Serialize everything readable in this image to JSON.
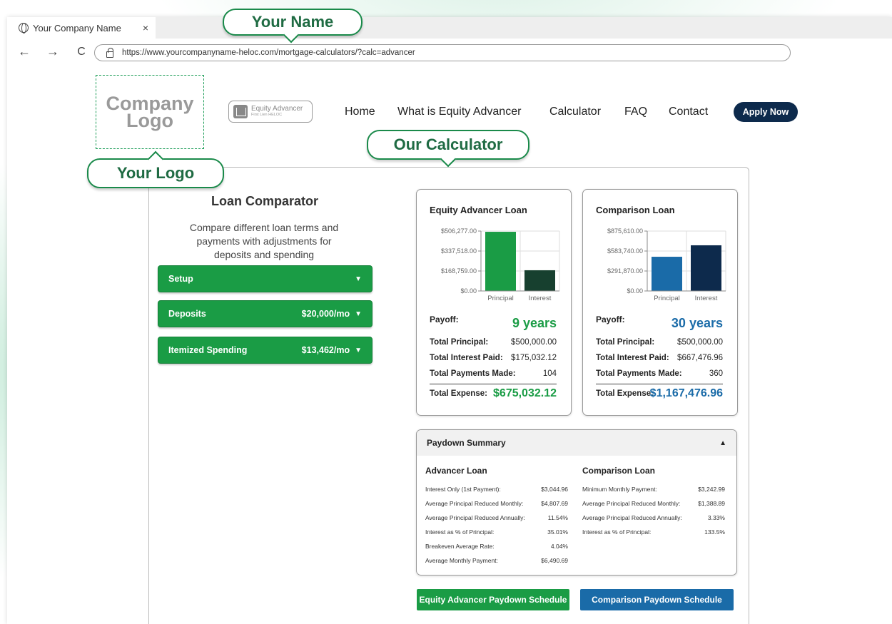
{
  "browser": {
    "tab_title": "Your Company Name",
    "tab_close": "×",
    "back": "←",
    "forward": "→",
    "reload": "C",
    "url": "https://www.yourcompanyname-heloc.com/mortgage-calculators/?calc=advancer"
  },
  "callouts": {
    "name": "Your Name",
    "logo": "Your Logo",
    "calculator": "Our Calculator"
  },
  "header": {
    "logo_line1": "Company",
    "logo_line2": "Logo",
    "badge_name": "Equity Advancer",
    "badge_sub": "First Lien HELOC",
    "nav": [
      "Home",
      "What is Equity Advancer",
      "Calculator",
      "FAQ",
      "Contact"
    ],
    "apply": "Apply Now"
  },
  "comparator": {
    "title": "Loan Comparator",
    "description": "Compare different loan terms and payments with adjustments for deposits and spending",
    "sections": [
      {
        "label": "Setup",
        "value": "",
        "arrow": "▼"
      },
      {
        "label": "Deposits",
        "value": "$20,000/mo",
        "arrow": "▼"
      },
      {
        "label": "Itemized Spending",
        "value": "$13,462/mo",
        "arrow": "▼"
      }
    ]
  },
  "colors": {
    "green": "#1a9c45",
    "dark_green": "#17402f",
    "blue": "#1a6ba8",
    "navy": "#0d2a4c"
  },
  "cards": [
    {
      "title": "Equity Advancer Loan",
      "payoff_label": "Payoff:",
      "payoff": "9 years",
      "rows": [
        {
          "label": "Total Principal:",
          "value": "$500,000.00"
        },
        {
          "label": "Total Interest Paid:",
          "value": "$175,032.12"
        },
        {
          "label": "Total Payments Made:",
          "value": "104"
        }
      ],
      "total_label": "Total Expense:",
      "total": "$675,032.12",
      "chart_data": {
        "type": "bar",
        "categories": [
          "Principal",
          "Interest"
        ],
        "values": [
          500000,
          175032.12
        ],
        "yticks": [
          0,
          168759,
          337518,
          506277
        ],
        "ytick_labels": [
          "$0.00",
          "$168,759.00",
          "$337,518.00",
          "$506,277.00"
        ],
        "ylim": [
          0,
          506277
        ],
        "colors": [
          "#1a9c45",
          "#17402f"
        ]
      }
    },
    {
      "title": "Comparison Loan",
      "payoff_label": "Payoff:",
      "payoff": "30 years",
      "rows": [
        {
          "label": "Total Principal:",
          "value": "$500,000.00"
        },
        {
          "label": "Total Interest Paid:",
          "value": "$667,476.96"
        },
        {
          "label": "Total Payments Made:",
          "value": "360"
        }
      ],
      "total_label": "Total Expense:",
      "total": "$1,167,476.96",
      "chart_data": {
        "type": "bar",
        "categories": [
          "Principal",
          "Interest"
        ],
        "values": [
          500000,
          667476.96
        ],
        "yticks": [
          0,
          291870,
          583740,
          875610
        ],
        "ytick_labels": [
          "$0.00",
          "$291,870.00",
          "$583,740.00",
          "$875,610.00"
        ],
        "ylim": [
          0,
          875610
        ],
        "colors": [
          "#1a6ba8",
          "#0d2a4c"
        ]
      }
    }
  ],
  "paydown": {
    "title": "Paydown Summary",
    "toggle": "▲",
    "advancer": {
      "title": "Advancer Loan",
      "rows": [
        {
          "label": "Interest Only (1st Payment):",
          "value": "$3,044.96"
        },
        {
          "label": "Average Principal Reduced Monthly:",
          "value": "$4,807.69"
        },
        {
          "label": "Average Principal Reduced Annually:",
          "value": "11.54%"
        },
        {
          "label": "Interest as % of Principal:",
          "value": "35.01%"
        },
        {
          "label": "Breakeven Average Rate:",
          "value": "4.04%"
        },
        {
          "label": "Average Monthly Payment:",
          "value": "$6,490.69"
        }
      ]
    },
    "comparison": {
      "title": "Comparison Loan",
      "rows": [
        {
          "label": "Minimum Monthly Payment:",
          "value": "$3,242.99"
        },
        {
          "label": "Average Principal Reduced Monthly:",
          "value": "$1,388.89"
        },
        {
          "label": "Average Principal Reduced Annually:",
          "value": "3.33%"
        },
        {
          "label": "Interest as % of Principal:",
          "value": "133.5%"
        }
      ]
    }
  },
  "buttons": {
    "advancer_schedule": "Equity Advancer Paydown Schedule",
    "comparison_schedule": "Comparison Paydown Schedule"
  }
}
